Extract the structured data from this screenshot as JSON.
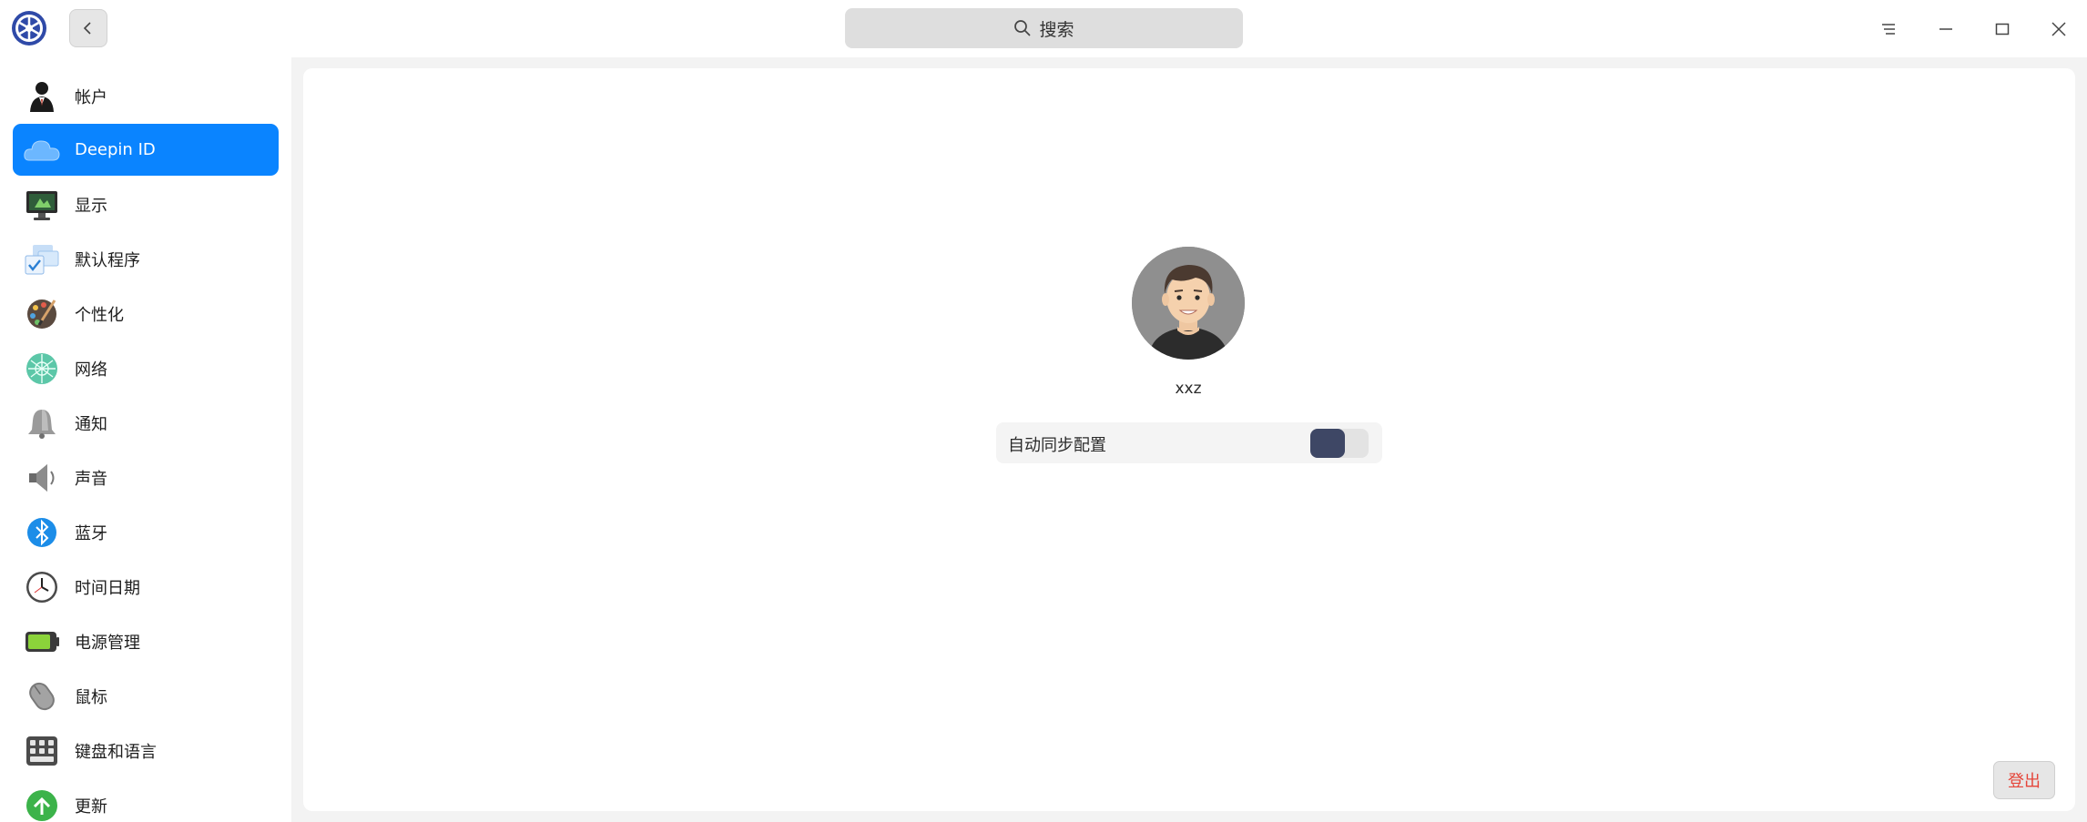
{
  "search": {
    "placeholder": "搜索"
  },
  "sidebar": {
    "items": [
      {
        "label": "帐户",
        "icon": "user-account-icon"
      },
      {
        "label": "Deepin ID",
        "icon": "cloud-icon",
        "active": true
      },
      {
        "label": "显示",
        "icon": "monitor-icon"
      },
      {
        "label": "默认程序",
        "icon": "default-apps-icon"
      },
      {
        "label": "个性化",
        "icon": "palette-icon"
      },
      {
        "label": "网络",
        "icon": "network-icon"
      },
      {
        "label": "通知",
        "icon": "bell-icon"
      },
      {
        "label": "声音",
        "icon": "speaker-icon"
      },
      {
        "label": "蓝牙",
        "icon": "bluetooth-icon"
      },
      {
        "label": "时间日期",
        "icon": "clock-icon"
      },
      {
        "label": "电源管理",
        "icon": "battery-icon"
      },
      {
        "label": "鼠标",
        "icon": "mouse-icon"
      },
      {
        "label": "键盘和语言",
        "icon": "keyboard-icon"
      },
      {
        "label": "更新",
        "icon": "update-icon"
      }
    ]
  },
  "main": {
    "username": "xxz",
    "sync": {
      "label": "自动同步配置",
      "enabled": true
    },
    "logout_label": "登出"
  },
  "colors": {
    "accent": "#0a84ff",
    "toggle_on": "#3e4765",
    "logout_text": "#e5453a"
  }
}
